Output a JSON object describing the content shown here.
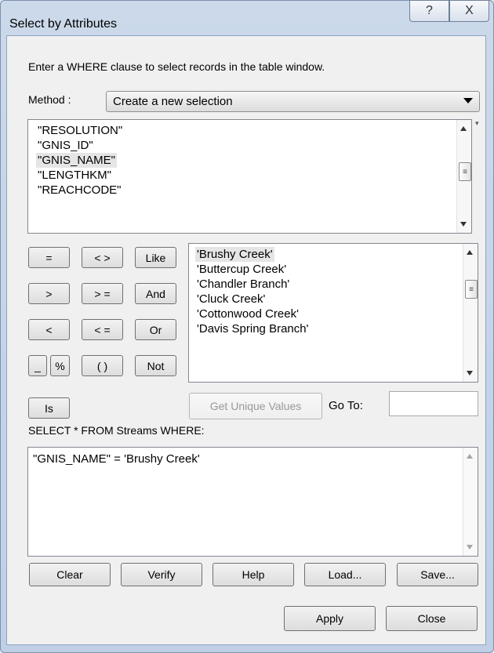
{
  "window": {
    "title": "Select by Attributes",
    "help_icon": "?",
    "close_icon": "X"
  },
  "instruction": "Enter a WHERE clause to select records in the table window.",
  "method": {
    "label": "Method :",
    "value": "Create a new selection"
  },
  "fields": [
    {
      "label": "\"RESOLUTION\"",
      "selected": false
    },
    {
      "label": "\"GNIS_ID\"",
      "selected": false
    },
    {
      "label": "\"GNIS_NAME\"",
      "selected": true
    },
    {
      "label": "\"LENGTHKM\"",
      "selected": false
    },
    {
      "label": "\"REACHCODE\"",
      "selected": false
    }
  ],
  "operators": {
    "eq": "=",
    "neq": "< >",
    "like": "Like",
    "gt": ">",
    "gte": "> =",
    "and": "And",
    "lt": "<",
    "lte": "< =",
    "or": "Or",
    "underscore": "_",
    "percent": "%",
    "parens": "( )",
    "not": "Not",
    "is": "Is"
  },
  "values": [
    {
      "label": "'Brushy Creek'",
      "selected": true
    },
    {
      "label": "'Buttercup Creek'",
      "selected": false
    },
    {
      "label": "'Chandler Branch'",
      "selected": false
    },
    {
      "label": "'Cluck Creek'",
      "selected": false
    },
    {
      "label": "'Cottonwood Creek'",
      "selected": false
    },
    {
      "label": "'Davis Spring Branch'",
      "selected": false
    }
  ],
  "get_unique_values": "Get Unique Values",
  "goto_label": "Go To:",
  "goto_value": "",
  "sql_prefix": "SELECT * FROM Streams WHERE:",
  "expression": "\"GNIS_NAME\" = 'Brushy Creek'",
  "buttons": {
    "clear": "Clear",
    "verify": "Verify",
    "help": "Help",
    "load": "Load...",
    "save": "Save...",
    "apply": "Apply",
    "close": "Close"
  }
}
